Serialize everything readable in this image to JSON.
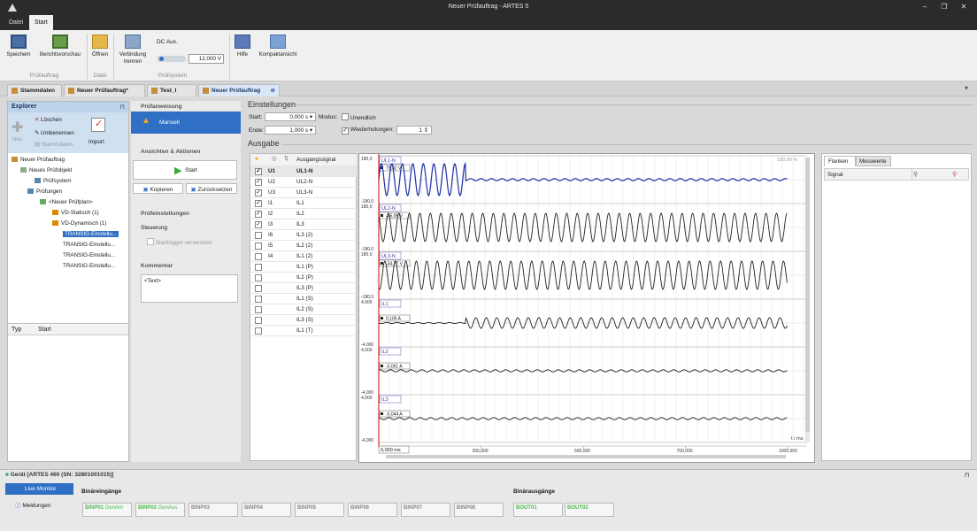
{
  "window": {
    "title": "Neuer Prüfauftrag - ARTES 5"
  },
  "ribbon_tabs": [
    "Datei",
    "Start"
  ],
  "ribbon": {
    "save": "Speichern",
    "report_preview": "Berichtsvorschau",
    "open": "Öffnen",
    "disconnect_line1": "Verbindung",
    "disconnect_line2": "trennen",
    "dc_aux_label": "DC Aux.",
    "dc_aux_value": "12,000 V",
    "help": "Hilfe",
    "compact": "Kompaktansicht",
    "group_pruefauftrag": "Prüfauftrag",
    "group_datei": "Datei",
    "group_pruefsystem": "Prüfsystem"
  },
  "doc_tabs": [
    "Stammdaten",
    "Neuer Prüfauftrag*",
    "Test_I",
    "Neuer Prüfauftrag"
  ],
  "explorer": {
    "title": "Explorer",
    "delete": "Löschen",
    "rename": "Umbenennen",
    "new": "Neu",
    "masterdata": "Stammdaten",
    "import": "Import",
    "tree": [
      "Neuer Prüfauftrag",
      "Neues Prüfobjekt",
      "Prüfsystem",
      "Prüfungen",
      "<Neuer Prüfplan>",
      "VD-Statisch (1)",
      "VD-Dynamisch (1)",
      "TRANSIG-Einstellu...",
      "TRANSIG-Einstellu...",
      "TRANSIG-Einstellu...",
      "TRANSIG-Einstellu..."
    ],
    "col_type": "Typ",
    "col_start": "Start"
  },
  "mid": {
    "pruefanweisung": "Prüfanweisung",
    "manual": "Manuell",
    "ansichten": "Ansichten & Aktionen",
    "start": "Start",
    "copy": "Kopieren",
    "reset": "Zurücksetzen",
    "pruefeinstellungen": "Prüfeinstellungen",
    "steuerung": "Steuerung",
    "starttrigger": "Starttrigger verwenden",
    "kommentar": "Kommentar",
    "comment_text": "<Text>"
  },
  "settings": {
    "title": "Einstellungen",
    "start_label": "Start:",
    "start_value": "0,000 s",
    "end_label": "Ende:",
    "end_value": "1,000 s",
    "mode_label": "Modus:",
    "infinite": "Unendlich",
    "repeat": "Wiederholungen:",
    "repeat_value": "1"
  },
  "output": {
    "title": "Ausgabe",
    "col_signal": "Ausgangssignal",
    "rows": [
      {
        "id": "U1",
        "sig": "UL1-N",
        "checked": true
      },
      {
        "id": "U2",
        "sig": "UL2-N",
        "checked": true
      },
      {
        "id": "U3",
        "sig": "UL3-N",
        "checked": true
      },
      {
        "id": "I1",
        "sig": "IL1",
        "checked": true
      },
      {
        "id": "I2",
        "sig": "IL2",
        "checked": true
      },
      {
        "id": "I3",
        "sig": "IL3",
        "checked": true
      },
      {
        "id": "I6",
        "sig": "IL3 (2)",
        "checked": false
      },
      {
        "id": "I5",
        "sig": "IL2 (2)",
        "checked": false
      },
      {
        "id": "I4",
        "sig": "IL1 (2)",
        "checked": false
      },
      {
        "id": "",
        "sig": "IL1 (P)",
        "checked": false
      },
      {
        "id": "",
        "sig": "IL2 (P)",
        "checked": false
      },
      {
        "id": "",
        "sig": "IL3 (P)",
        "checked": false
      },
      {
        "id": "",
        "sig": "IL1 (S)",
        "checked": false
      },
      {
        "id": "",
        "sig": "IL2 (S)",
        "checked": false
      },
      {
        "id": "",
        "sig": "IL3 (S)",
        "checked": false
      },
      {
        "id": "",
        "sig": "IL1 (T)",
        "checked": false
      }
    ]
  },
  "plot": {
    "zoom": "100,00 %",
    "time_unit": "t / ms",
    "cursor": "0,000 ms",
    "x_ticks": [
      "250,000",
      "500,000",
      "750,000",
      "1000,000"
    ],
    "channels": [
      {
        "name": "UL1-N",
        "ymax": "180,0",
        "ymin": "-180,0",
        "readout": "79,82 V"
      },
      {
        "name": "UL2-N",
        "ymax": "180,0",
        "ymin": "-180,0",
        "readout": "-45,05 V"
      },
      {
        "name": "UL3-N",
        "ymax": "180,0",
        "ymin": "-180,0",
        "readout": "-34,77 V"
      },
      {
        "name": "IL1",
        "ymax": "4,000",
        "ymin": "-4,000",
        "readout": "0,105 A"
      },
      {
        "name": "IL2",
        "ymax": "4,000",
        "ymin": "-4,000",
        "readout": "-0,061 A"
      },
      {
        "name": "IL3",
        "ymax": "4,000",
        "ymin": "-4,000",
        "readout": "-0,044 A"
      }
    ]
  },
  "rightpanel": {
    "tab_flanks": "Flanken",
    "tab_measure": "Messwerte",
    "col_signal": "Signal"
  },
  "device": {
    "title": "Gerät [ARTES 460 (SN: 32801001015)]",
    "live_monitor": "Live Monitor",
    "messages": "Meldungen",
    "binary_inputs": "Binäreingänge",
    "binary_outputs": "Binärausgänge",
    "binp": [
      {
        "name": "BINP01",
        "state": "GenAm"
      },
      {
        "name": "BINP02",
        "state": "GenAus"
      },
      {
        "name": "BINP03",
        "state": ""
      },
      {
        "name": "BINP04",
        "state": ""
      },
      {
        "name": "BINP05",
        "state": ""
      },
      {
        "name": "BINP06",
        "state": ""
      },
      {
        "name": "BINP07",
        "state": ""
      },
      {
        "name": "BINP08",
        "state": ""
      }
    ],
    "bout": [
      "BOUT01",
      "BOUT02"
    ]
  },
  "colors": {
    "accent": "#2f6fc4",
    "trace_u1": "#1f2fa8",
    "trace_dark": "#222222",
    "cursor": "#cc0000"
  }
}
